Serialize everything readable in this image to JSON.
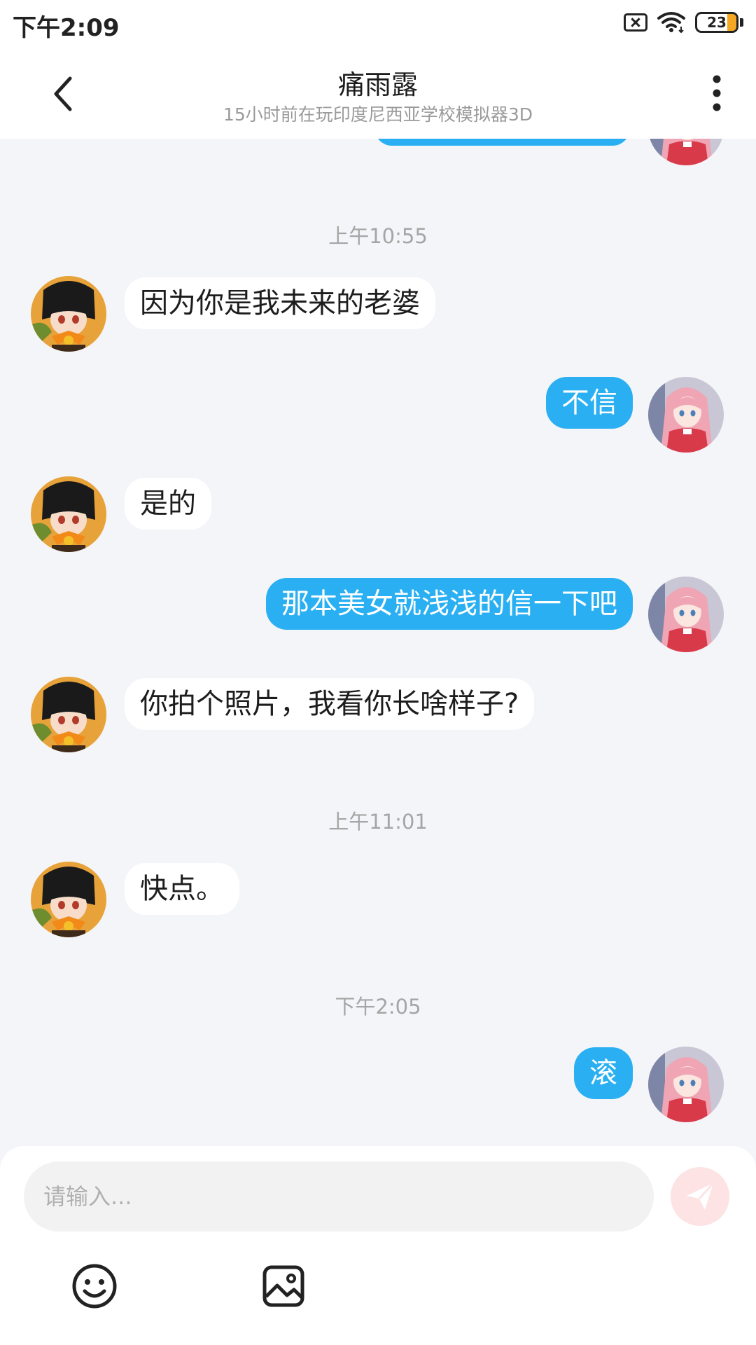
{
  "status_bar": {
    "time": "下午2:09",
    "battery": "23",
    "battery_level": 0.23,
    "icons": [
      "sim-off-icon",
      "wifi-icon",
      "battery-icon"
    ]
  },
  "header": {
    "title": "痛雨露",
    "subtitle": "15小时前在玩印度尼西亚学校模拟器3D",
    "back_icon": "back-arrow-icon",
    "more_icon": "more-vertical-icon"
  },
  "colors": {
    "outgoing_bubble": "#2ab0f2",
    "incoming_bubble": "#ffffff",
    "background": "#f4f5f8",
    "send_button": "#fde3e3"
  },
  "timestamps": [
    "上午10:55",
    "上午11:01",
    "下午2:05"
  ],
  "messages": [
    {
      "side": "in",
      "text": "因为你是我未来的老婆"
    },
    {
      "side": "out",
      "text": "不信"
    },
    {
      "side": "in",
      "text": "是的"
    },
    {
      "side": "out",
      "text": "那本美女就浅浅的信一下吧"
    },
    {
      "side": "in",
      "text": "你拍个照片，我看你长啥样子?"
    },
    {
      "side": "in",
      "text": "快点。"
    },
    {
      "side": "out",
      "text": "滚"
    }
  ],
  "input": {
    "placeholder": "请输入..."
  },
  "toolbar": {
    "icons": [
      "emoji-icon",
      "image-icon",
      "send-icon"
    ]
  }
}
